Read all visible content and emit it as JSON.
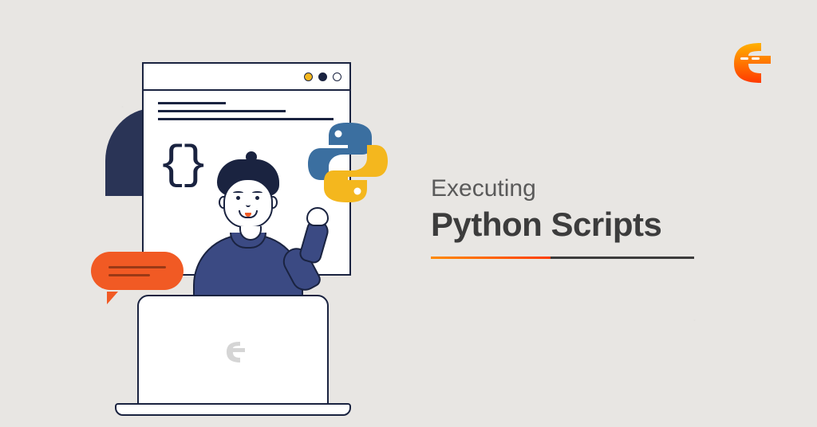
{
  "title": {
    "line1": "Executing",
    "line2": "Python Scripts"
  },
  "icons": {
    "logo_name": "coding-ninjas-logo",
    "python_name": "python-logo",
    "chat_name": "chat-bubble",
    "laptop_logo_name": "coding-ninjas-logo-faded"
  },
  "colors": {
    "accent_orange": "#ff5a01",
    "accent_gradient_start": "#ff8a00",
    "dark_navy": "#1a2340",
    "body_blue": "#3b4a83",
    "chat_orange": "#f15a24",
    "python_blue": "#3b6fa0",
    "python_yellow": "#f4b71e"
  }
}
